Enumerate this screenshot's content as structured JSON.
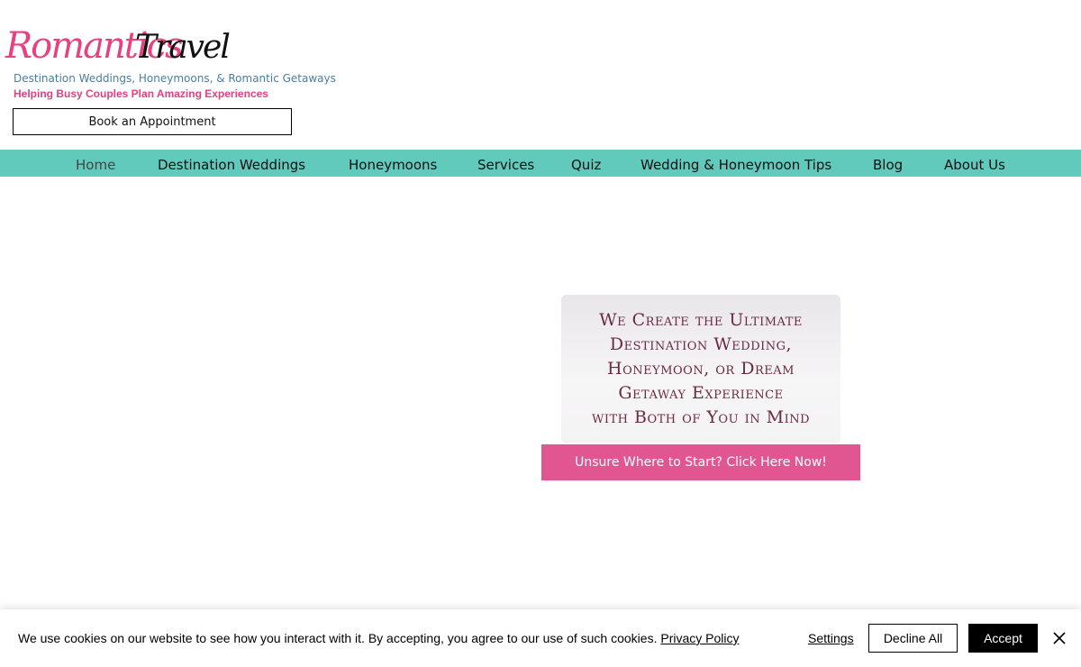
{
  "header": {
    "logo_part_1": "Romantics",
    "logo_part_2": "Travel",
    "tagline": "Destination Weddings, Honeymoons, & Romantic Getaways",
    "subtagline": "Helping Busy Couples Plan Amazing Experiences",
    "book_button": "Book an Appointment"
  },
  "nav": {
    "items": [
      {
        "label": "Home",
        "active": true
      },
      {
        "label": "Destination Weddings"
      },
      {
        "label": "Honeymoons"
      },
      {
        "label": "Services"
      },
      {
        "label": "Quiz"
      },
      {
        "label": "Wedding & Honeymoon Tips"
      },
      {
        "label": "Blog"
      },
      {
        "label": "About Us"
      }
    ]
  },
  "hero": {
    "lines": [
      "We Create the Ultimate",
      "Destination Wedding,",
      "Honeymoon, or Dream",
      "Getaway Experience",
      "with Both of You in Mind"
    ],
    "cta": "Unsure Where to Start? Click Here Now!"
  },
  "cookie_banner": {
    "message": "We use cookies on our website to see how you interact with it. By accepting, you agree to our use of such cookies.",
    "privacy_link": "Privacy Policy",
    "settings": "Settings",
    "decline": "Decline All",
    "accept": "Accept"
  },
  "colors": {
    "brand_pink": "#e8417f",
    "nav_teal": "#62c9bd",
    "cta_pink": "#e15690",
    "hero_text": "#6b2a3e"
  },
  "icons": {
    "close": "close-icon"
  }
}
